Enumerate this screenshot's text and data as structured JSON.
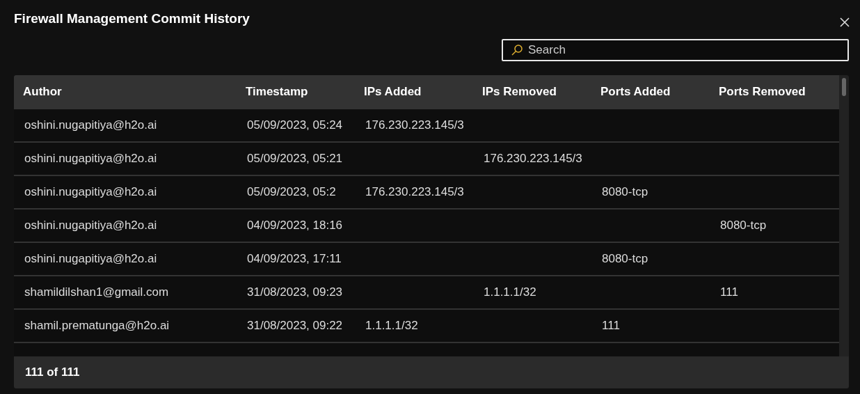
{
  "dialog": {
    "title": "Firewall Management Commit History"
  },
  "search": {
    "placeholder": "Search"
  },
  "table": {
    "columns": [
      "Author",
      "Timestamp",
      "IPs Added",
      "IPs Removed",
      "Ports Added",
      "Ports Removed"
    ],
    "rows": [
      [
        "oshini.nugapitiya@h2o.ai",
        "05/09/2023, 05:24",
        "176.230.223.145/3",
        "",
        "",
        ""
      ],
      [
        "oshini.nugapitiya@h2o.ai",
        "05/09/2023, 05:21",
        "",
        "176.230.223.145/3",
        "",
        ""
      ],
      [
        "oshini.nugapitiya@h2o.ai",
        "05/09/2023, 05:2",
        "176.230.223.145/3",
        "",
        "8080-tcp",
        ""
      ],
      [
        "oshini.nugapitiya@h2o.ai",
        "04/09/2023, 18:16",
        "",
        "",
        "",
        "8080-tcp"
      ],
      [
        "oshini.nugapitiya@h2o.ai",
        "04/09/2023, 17:11",
        "",
        "",
        "8080-tcp",
        ""
      ],
      [
        "shamildilshan1@gmail.com",
        "31/08/2023, 09:23",
        "",
        "1.1.1.1/32",
        "",
        "111"
      ],
      [
        "shamil.prematunga@h2o.ai",
        "31/08/2023, 09:22",
        "1.1.1.1/32",
        "",
        "111",
        ""
      ]
    ]
  },
  "footer": {
    "count": "111 of 111"
  }
}
